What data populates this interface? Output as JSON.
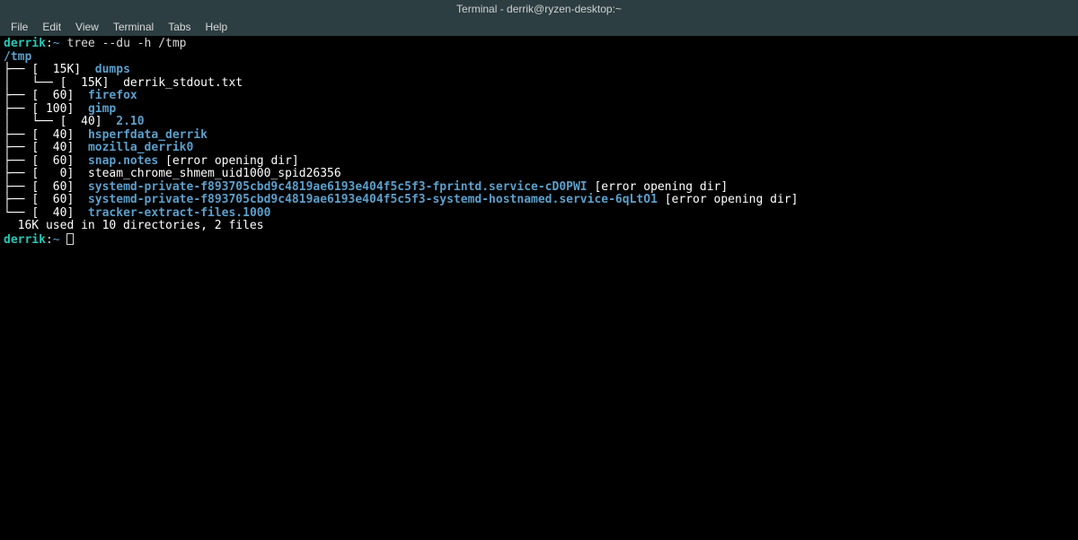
{
  "window": {
    "title": "Terminal - derrik@ryzen-desktop:~"
  },
  "menu": {
    "items": [
      "File",
      "Edit",
      "View",
      "Terminal",
      "Tabs",
      "Help"
    ]
  },
  "prompt": {
    "user": "derrik",
    "sep": ":",
    "tilde": "~"
  },
  "command": "tree --du -h /tmp",
  "tree": {
    "root": "/tmp",
    "lines": [
      {
        "prefix": "├── ",
        "size": "[  15K]  ",
        "name": "dumps",
        "type": "dir",
        "suffix": ""
      },
      {
        "prefix": "│   └── ",
        "size": "[  15K]  ",
        "name": "derrik_stdout.txt",
        "type": "file",
        "suffix": ""
      },
      {
        "prefix": "├── ",
        "size": "[  60]  ",
        "name": "firefox",
        "type": "dir",
        "suffix": ""
      },
      {
        "prefix": "├── ",
        "size": "[ 100]  ",
        "name": "gimp",
        "type": "dir",
        "suffix": ""
      },
      {
        "prefix": "│   └── ",
        "size": "[  40]  ",
        "name": "2.10",
        "type": "dir",
        "suffix": ""
      },
      {
        "prefix": "├── ",
        "size": "[  40]  ",
        "name": "hsperfdata_derrik",
        "type": "dir",
        "suffix": ""
      },
      {
        "prefix": "├── ",
        "size": "[  40]  ",
        "name": "mozilla_derrik0",
        "type": "dir",
        "suffix": ""
      },
      {
        "prefix": "├── ",
        "size": "[  60]  ",
        "name": "snap.notes",
        "type": "dir",
        "suffix": " [error opening dir]"
      },
      {
        "prefix": "├── ",
        "size": "[   0]  ",
        "name": "steam_chrome_shmem_uid1000_spid26356",
        "type": "file",
        "suffix": ""
      },
      {
        "prefix": "├── ",
        "size": "[  60]  ",
        "name": "systemd-private-f893705cbd9c4819ae6193e404f5c5f3-fprintd.service-cD0PWI",
        "type": "dir",
        "suffix": " [error opening dir]"
      },
      {
        "prefix": "├── ",
        "size": "[  60]  ",
        "name": "systemd-private-f893705cbd9c4819ae6193e404f5c5f3-systemd-hostnamed.service-6qLtO1",
        "type": "dir",
        "suffix": " [error opening dir]"
      },
      {
        "prefix": "└── ",
        "size": "[  40]  ",
        "name": "tracker-extract-files.1000",
        "type": "dir",
        "suffix": ""
      }
    ],
    "summary": "  16K used in 10 directories, 2 files"
  }
}
